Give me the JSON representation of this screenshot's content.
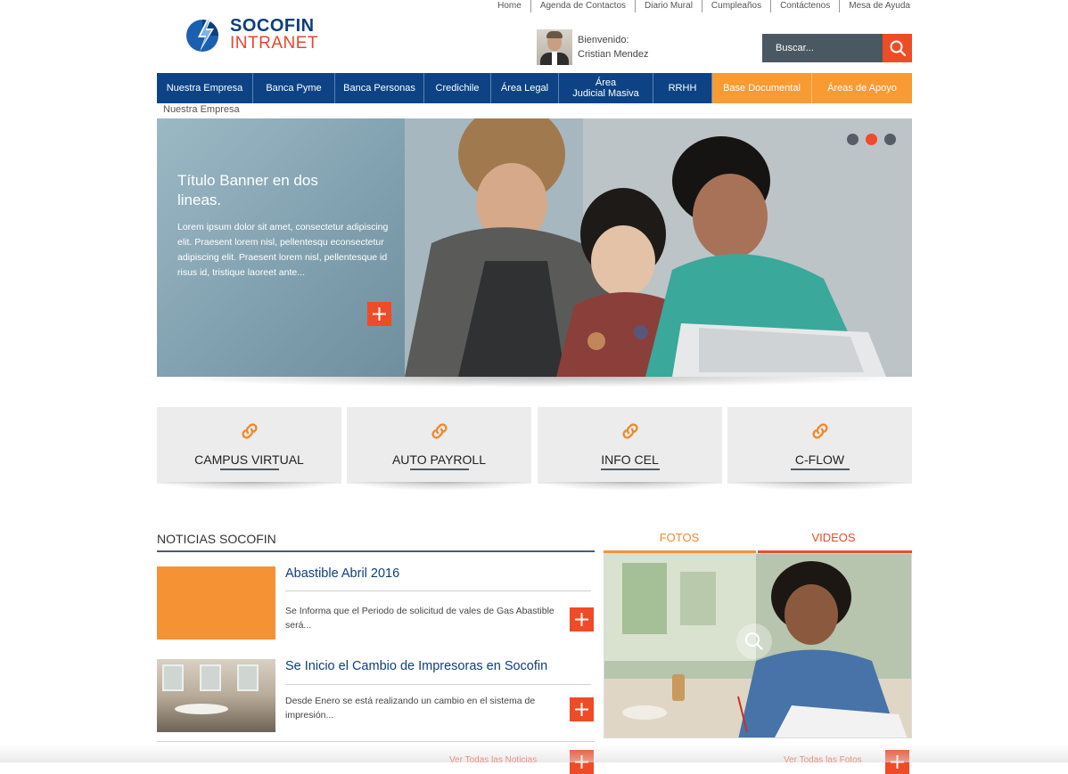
{
  "top_links": [
    "Home",
    "Agenda de Contactos",
    "Diario Mural",
    "Cumpleaños",
    "Contáctenos",
    "Mesa de Ayuda"
  ],
  "logo": {
    "line1": "SOCOFIN",
    "line2": "INTRANET"
  },
  "user": {
    "greeting": "Bienvenido:",
    "name": "Cristian Mendez"
  },
  "search": {
    "placeholder": "Buscar..."
  },
  "nav": [
    {
      "label": "Nuestra Empresa"
    },
    {
      "label": "Banca Pyme"
    },
    {
      "label": "Banca Personas"
    },
    {
      "label": "Credichile"
    },
    {
      "label": "Área Legal"
    },
    {
      "label_line1": "Área",
      "label_line2": "Judicial Masiva"
    },
    {
      "label": "RRHH"
    },
    {
      "label": "Base Documental"
    },
    {
      "label": "Áreas de Apoyo"
    }
  ],
  "breadcrumb": "Nuestra Empresa",
  "banner": {
    "title": "Título Banner en dos lineas.",
    "body": "Lorem ipsum dolor sit amet, consectetur adipiscing elit. Praesent lorem nisl, pellentesqu econsectetur adipiscing elit. Praesent lorem nisl, pellentesque id risus id, tristique laoreet ante...",
    "slides": 3,
    "active_slide": 2
  },
  "quick_links": [
    "CAMPUS VIRTUAL",
    "AUTO PAYROLL",
    "INFO CEL",
    "C-FLOW"
  ],
  "news": {
    "title": "NOTICIAS SOCOFIN",
    "items": [
      {
        "headline": "Abastible Abril 2016",
        "summary": "Se Informa que el Periodo de solicitud de vales de Gas Abastible será..."
      },
      {
        "headline": "Se Inicio el Cambio de Impresoras en Socofin",
        "summary": "Desde Enero se está realizando un cambio en el sistema de impresión..."
      }
    ],
    "see_all": "Ver Todas las Noticias"
  },
  "media": {
    "tabs": [
      "FOTOS",
      "VIDEOS"
    ],
    "see_all": "Ver Todas las Fotos"
  },
  "colors": {
    "brand_blue": "#0d4385",
    "accent_orange": "#f79b32",
    "accent_red": "#ef4b26",
    "dark_slate": "#4e5b66"
  }
}
